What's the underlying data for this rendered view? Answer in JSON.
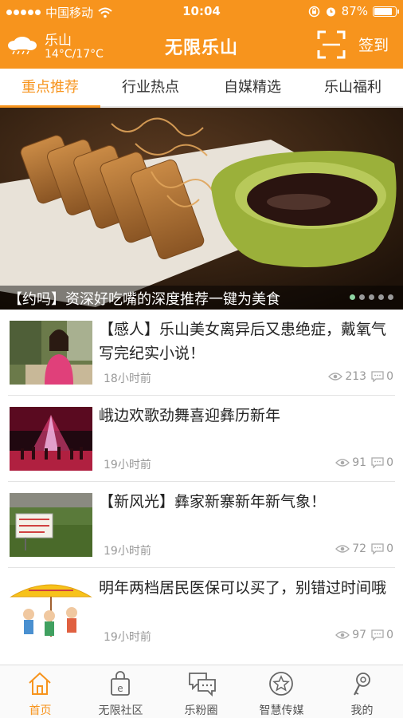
{
  "status_bar": {
    "carrier": "中国移动",
    "time": "10:04",
    "battery": "87%",
    "battery_level": 0.87,
    "icons": [
      "signal-dots-icon",
      "wifi-icon",
      "orientation-lock-icon",
      "alarm-icon",
      "battery-icon"
    ]
  },
  "header": {
    "city": "乐山",
    "temperature": "14°C/17°C",
    "title": "无限乐山",
    "signin": "签到",
    "icons": [
      "cloud-icon",
      "scan-icon"
    ],
    "bg_color": "#f7941d"
  },
  "tabs": [
    {
      "label": "重点推荐",
      "active": true
    },
    {
      "label": "行业热点",
      "active": false
    },
    {
      "label": "自媒精选",
      "active": false
    },
    {
      "label": "乐山福利",
      "active": false
    }
  ],
  "banner": {
    "caption": "【约吗】资深好吃嘴的深度推荐一键为美食",
    "page_count": 5,
    "current_page": 1
  },
  "news": [
    {
      "title": "【感人】乐山美女离异后又患绝症，戴氧气写完纪实小说！",
      "time": "18小时前",
      "views": "213",
      "comments": "0"
    },
    {
      "title": "峨边欢歌劲舞喜迎彝历新年",
      "time": "19小时前",
      "views": "91",
      "comments": "0"
    },
    {
      "title": "【新风光】彝家新寨新年新气象！",
      "time": "19小时前",
      "views": "72",
      "comments": "0"
    },
    {
      "title": "明年两档居民医保可以买了，别错过时间哦",
      "time": "19小时前",
      "views": "97",
      "comments": "0"
    }
  ],
  "bottom_nav": [
    {
      "label": "首页",
      "icon": "home-icon",
      "active": true
    },
    {
      "label": "无限社区",
      "icon": "community-bag-icon",
      "active": false
    },
    {
      "label": "乐粉圈",
      "icon": "chat-bubbles-icon",
      "active": false
    },
    {
      "label": "智慧传媒",
      "icon": "star-circle-icon",
      "active": false
    },
    {
      "label": "我的",
      "icon": "profile-icon",
      "active": false
    }
  ],
  "colors": {
    "accent": "#f7941d",
    "text": "#222222",
    "muted": "#999999"
  }
}
